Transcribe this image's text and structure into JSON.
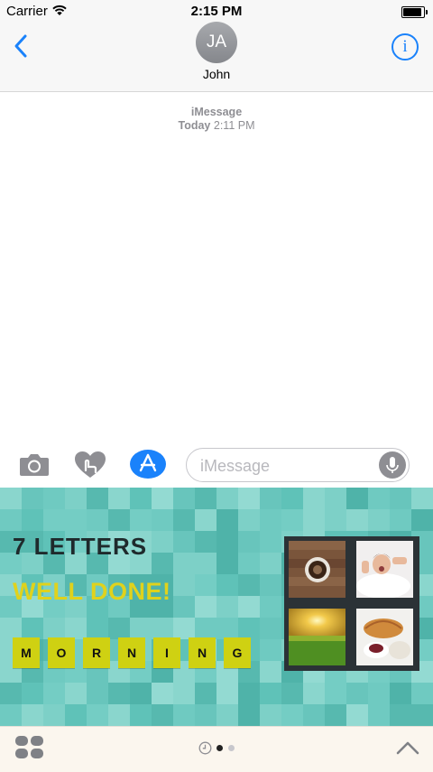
{
  "status_bar": {
    "carrier": "Carrier",
    "time": "2:15 PM"
  },
  "header": {
    "avatar_initials": "JA",
    "contact_name": "John"
  },
  "thread": {
    "service": "iMessage",
    "day": "Today",
    "time": "2:11 PM"
  },
  "composer": {
    "placeholder": "iMessage"
  },
  "sticker": {
    "title": "7 LETTERS",
    "result": "WELL DONE!",
    "letters": [
      "M",
      "O",
      "R",
      "N",
      "I",
      "N",
      "G"
    ],
    "tile_color": "#cfd112",
    "result_color": "#e0d21c",
    "images": [
      "coffee-cup-photo",
      "waking-woman-photo",
      "sunrise-field-photo",
      "breakfast-croissant-photo"
    ]
  },
  "icons": {
    "back": "chevron-left-icon",
    "info": "info-icon",
    "camera": "camera-icon",
    "digital_touch": "heart-touch-icon",
    "app_store": "app-store-icon",
    "mic": "microphone-icon",
    "app_drawer": "app-grid-icon",
    "recents": "clock-icon",
    "expand": "chevron-up-icon"
  },
  "colors": {
    "accent": "#1a82fb",
    "panel_bg": "#6ec9c0"
  }
}
